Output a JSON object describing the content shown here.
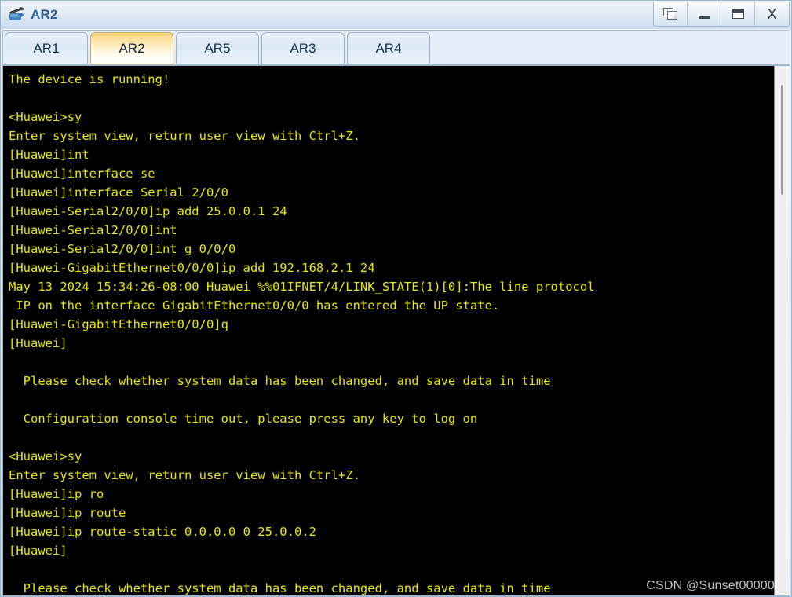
{
  "window": {
    "title": "AR2",
    "icon": "router-icon",
    "controls": [
      {
        "name": "restore-button",
        "label": "",
        "icon": "restore-icon"
      },
      {
        "name": "minimize-button",
        "label": "_",
        "icon": "minimize-icon"
      },
      {
        "name": "maximize-button",
        "label": "",
        "icon": "maximize-icon"
      },
      {
        "name": "close-button",
        "label": "X",
        "icon": "close-icon"
      }
    ]
  },
  "tabs": [
    {
      "label": "AR1",
      "active": false
    },
    {
      "label": "AR2",
      "active": true
    },
    {
      "label": "AR5",
      "active": false
    },
    {
      "label": "AR3",
      "active": false
    },
    {
      "label": "AR4",
      "active": false
    }
  ],
  "terminal": {
    "foreground_color": "#e8e800",
    "background_color": "#000000",
    "lines": [
      "The device is running!",
      "",
      "<Huawei>sy",
      "Enter system view, return user view with Ctrl+Z.",
      "[Huawei]int",
      "[Huawei]interface se",
      "[Huawei]interface Serial 2/0/0",
      "[Huawei-Serial2/0/0]ip add 25.0.0.1 24",
      "[Huawei-Serial2/0/0]int",
      "[Huawei-Serial2/0/0]int g 0/0/0",
      "[Huawei-GigabitEthernet0/0/0]ip add 192.168.2.1 24",
      "May 13 2024 15:34:26-08:00 Huawei %%01IFNET/4/LINK_STATE(1)[0]:The line protocol",
      " IP on the interface GigabitEthernet0/0/0 has entered the UP state.",
      "[Huawei-GigabitEthernet0/0/0]q",
      "[Huawei]",
      "",
      "  Please check whether system data has been changed, and save data in time",
      "",
      "  Configuration console time out, please press any key to log on",
      "",
      "<Huawei>sy",
      "Enter system view, return user view with Ctrl+Z.",
      "[Huawei]ip ro",
      "[Huawei]ip route",
      "[Huawei]ip route-static 0.0.0.0 0 25.0.0.2",
      "[Huawei]",
      "",
      "  Please check whether system data has been changed, and save data in time"
    ]
  },
  "scrollbar": {
    "name": "vertical-scrollbar"
  },
  "watermark": {
    "text": "CSDN @Sunset00000"
  }
}
